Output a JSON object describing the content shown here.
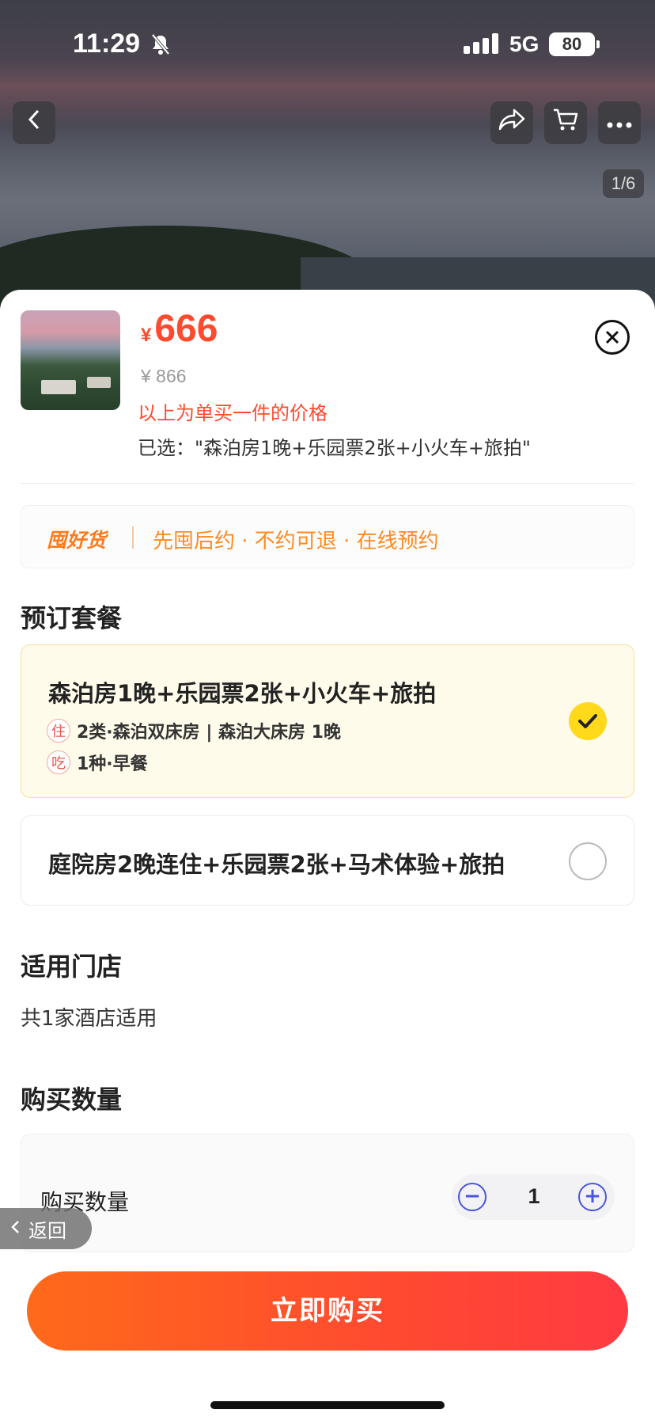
{
  "status": {
    "time": "11:29",
    "network": "5G",
    "battery": "80"
  },
  "gallery": {
    "pager": "1/6"
  },
  "product": {
    "currency": "¥",
    "price": "666",
    "original_price": "¥ 866",
    "note": "以上为单买一件的价格",
    "selected": "已选：\"森泊房1晚+乐园票2张+小火车+旅拍\""
  },
  "promo": {
    "logo": "囤好货",
    "text": "先囤后约 · 不约可退 · 在线预约"
  },
  "packages": {
    "title": "预订套餐",
    "items": [
      {
        "title": "森泊房1晚+乐园票2张+小火车+旅拍",
        "stay_tag": "住",
        "stay": "2类·森泊双床房 | 森泊大床房 1晚",
        "food_tag": "吃",
        "food": "1种·早餐",
        "selected": true
      },
      {
        "title": "庭院房2晚连住+乐园票2张+马术体验+旅拍",
        "selected": false
      }
    ]
  },
  "stores": {
    "title": "适用门店",
    "text": "共1家酒店适用"
  },
  "quantity": {
    "title": "购买数量",
    "label": "购买数量",
    "value": "1"
  },
  "return_label": "返回",
  "buy_label": "立即购买",
  "colors": {
    "accent": "#ff4a2e",
    "selected_bg": "#fffbea",
    "check": "#ffd91a",
    "stepper": "#4a55e0"
  }
}
